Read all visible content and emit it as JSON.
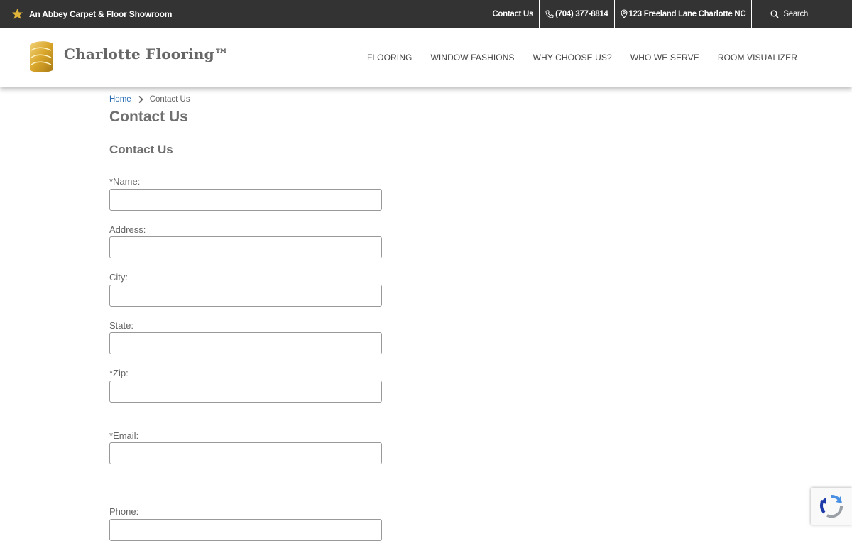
{
  "topbar": {
    "brand": "An Abbey Carpet & Floor Showroom",
    "contact": "Contact Us",
    "phone": "(704) 377-8814",
    "address": "123 Freeland Lane Charlotte NC",
    "search": "Search"
  },
  "header": {
    "logo_text": "Charlotte Flooring™",
    "nav": [
      "FLOORING",
      "WINDOW FASHIONS",
      "WHY CHOOSE US?",
      "WHO WE SERVE",
      "ROOM VISUALIZER"
    ]
  },
  "breadcrumb": {
    "home": "Home",
    "current": "Contact Us"
  },
  "page_title": "Contact Us",
  "form": {
    "title": "Contact Us",
    "fields": {
      "name": {
        "label": "*Name:",
        "value": ""
      },
      "address": {
        "label": "Address:",
        "value": ""
      },
      "city": {
        "label": "City:",
        "value": ""
      },
      "state": {
        "label": "State:",
        "value": ""
      },
      "zip": {
        "label": "*Zip:",
        "value": ""
      },
      "email": {
        "label": "*Email:",
        "value": ""
      },
      "phone": {
        "label": "Phone:",
        "value": ""
      }
    }
  },
  "icons": {
    "brand": "star-icon",
    "phone": "phone-icon",
    "address": "map-pin-icon",
    "search": "search-icon",
    "breadcrumb_sep": "chevron-right-icon",
    "captcha": "recaptcha-icon"
  },
  "colors": {
    "topbar_bg": "#333333",
    "brand_gold": "#d9a62b",
    "link_blue": "#2a6db5",
    "heading_gray": "#707070"
  }
}
